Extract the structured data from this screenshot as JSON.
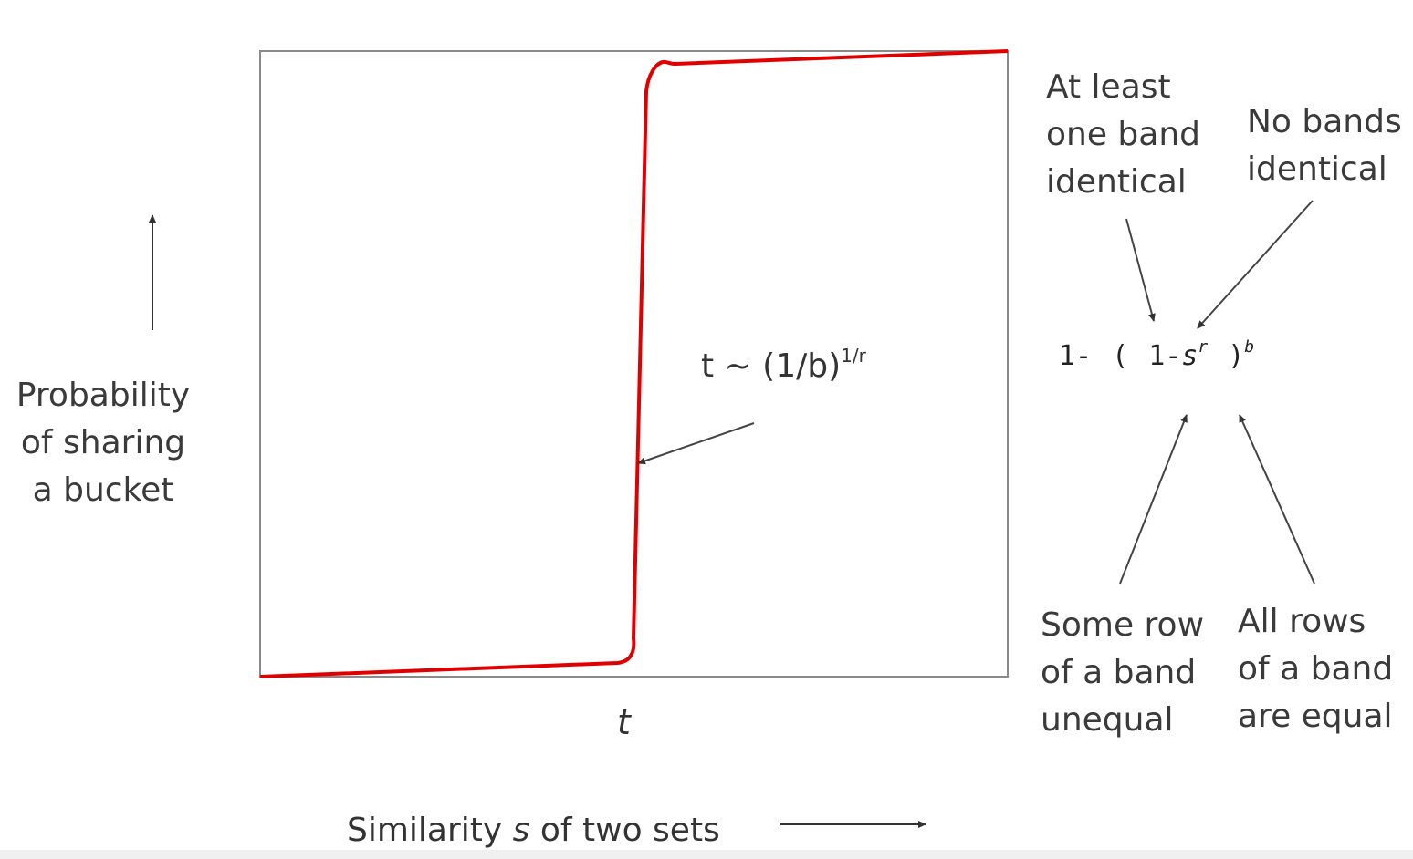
{
  "y_axis": {
    "label_lines": [
      "Probability",
      "of sharing",
      "a bucket"
    ]
  },
  "x_axis": {
    "label_prefix": "Similarity ",
    "label_var": "s",
    "label_suffix": " of two sets"
  },
  "threshold_tick": "t",
  "threshold_note": {
    "base": "t ~ (1/b)",
    "exp": "1/r"
  },
  "formula": {
    "p1": "1-",
    "p2": "(",
    "p3": "1-",
    "s": "s",
    "r": "r",
    "p4": ")",
    "b": "b"
  },
  "annotations": {
    "at_least_one": [
      "At least",
      "one band",
      "identical"
    ],
    "no_bands": [
      "No bands",
      "identical"
    ],
    "some_row": [
      "Some row",
      "of a band",
      "unequal"
    ],
    "all_rows": [
      "All rows",
      "of a band",
      "are equal"
    ]
  },
  "colors": {
    "curve": "#e00000",
    "frame": "#8a8a8a",
    "arrow": "#444444"
  }
}
